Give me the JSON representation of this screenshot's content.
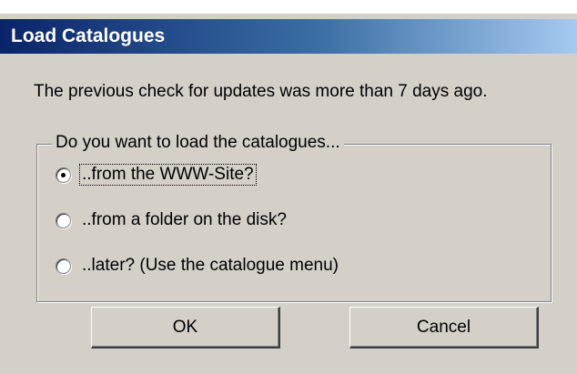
{
  "dialog": {
    "title": "Load Catalogues",
    "message": "The previous check for updates was more than 7 days ago.",
    "group_label": "Do you want to load the catalogues...",
    "options": [
      {
        "label": "..from the WWW-Site?",
        "selected": true
      },
      {
        "label": "..from a folder on the disk?",
        "selected": false
      },
      {
        "label": "..later? (Use the catalogue menu)",
        "selected": false
      }
    ],
    "buttons": {
      "ok": "OK",
      "cancel": "Cancel"
    }
  },
  "colors": {
    "window_bg": "#d4d0c8",
    "titlebar_start": "#0a246a",
    "titlebar_end": "#a6caf0",
    "title_text": "#ffffff"
  }
}
